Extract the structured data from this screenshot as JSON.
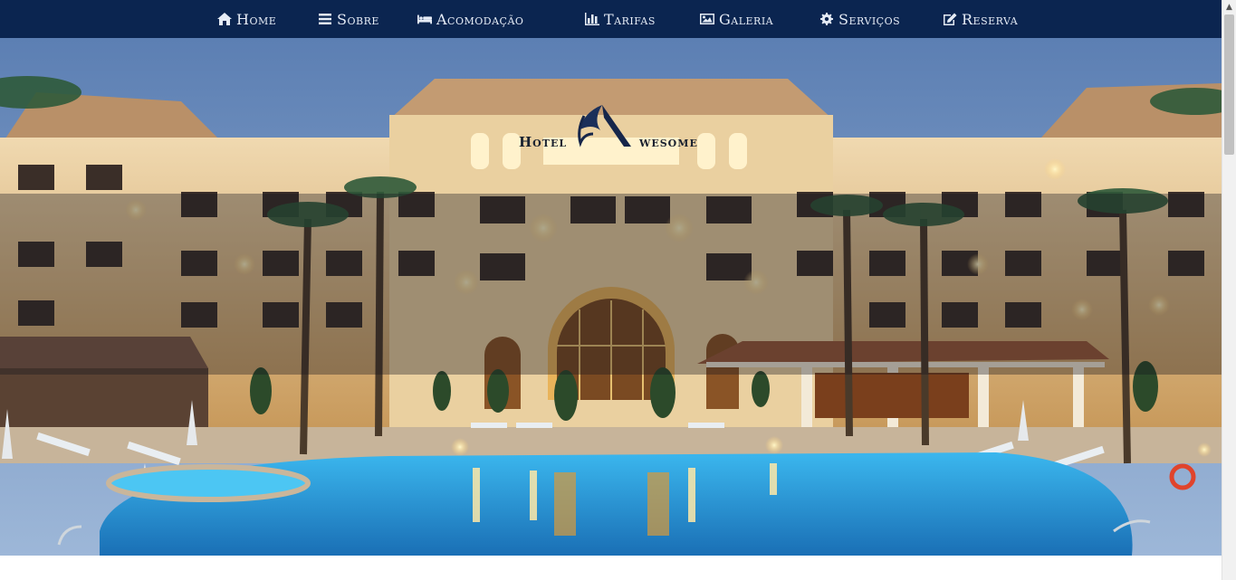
{
  "nav": {
    "items": [
      {
        "label": "Home",
        "icon": "home-icon"
      },
      {
        "label": "Sobre",
        "icon": "bars-icon"
      },
      {
        "label": "Acomodação",
        "icon": "bed-icon"
      },
      {
        "label": "Tarifas",
        "icon": "bar-chart-icon"
      },
      {
        "label": "Galeria",
        "icon": "image-icon"
      },
      {
        "label": "Serviços",
        "icon": "gear-icon"
      },
      {
        "label": "Reserva",
        "icon": "edit-icon"
      }
    ]
  },
  "logo": {
    "word_left": "Hotel",
    "word_right": "wesome"
  },
  "colors": {
    "navbar": "#0b2550",
    "nav_text": "#e6ecf6",
    "sky": "#6f8fbe",
    "building": "#e7c38a",
    "pool": "#2fa6e0"
  }
}
